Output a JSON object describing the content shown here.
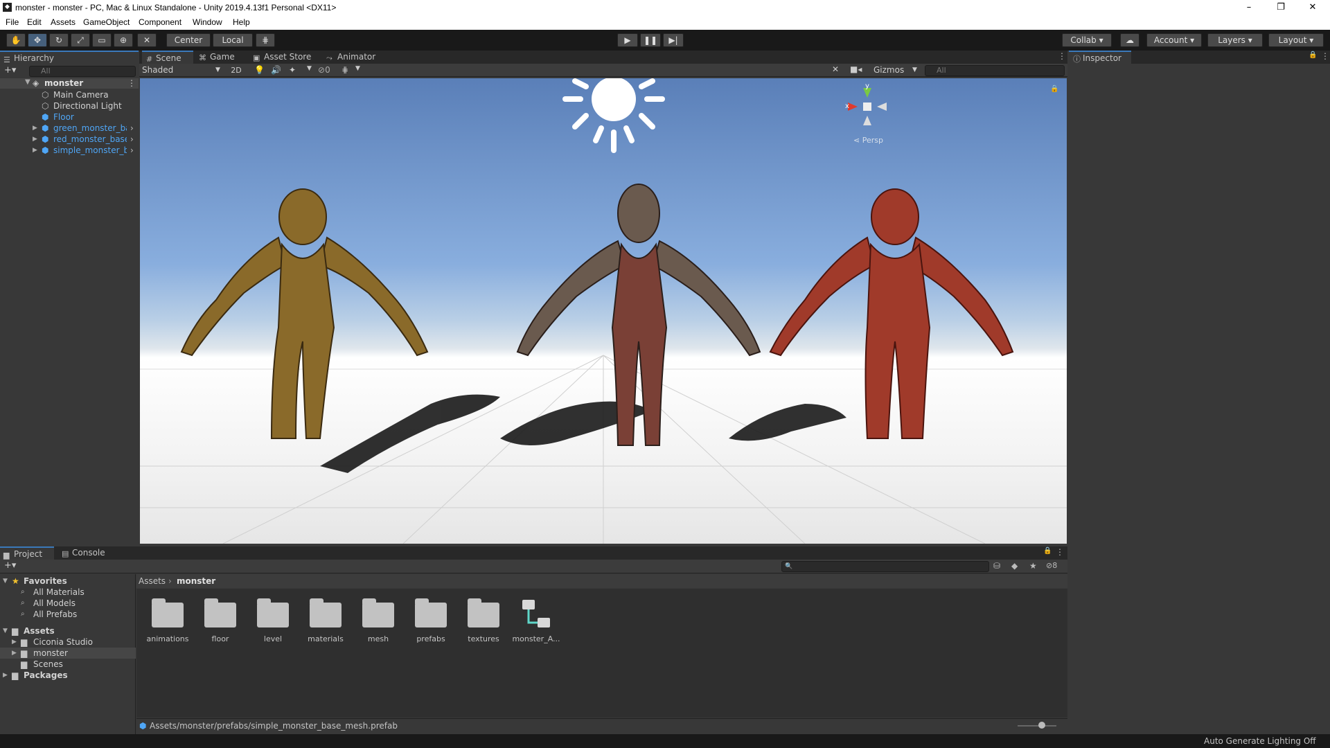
{
  "window": {
    "title": "monster - monster - PC, Mac & Linux Standalone - Unity 2019.4.13f1 Personal <DX11>",
    "minimize": "–",
    "restore": "❐",
    "close": "✕"
  },
  "menu": [
    "File",
    "Edit",
    "Assets",
    "GameObject",
    "Component",
    "Window",
    "Help"
  ],
  "toolbar": {
    "pivot": "Center",
    "space": "Local",
    "collab": "Collab",
    "account": "Account",
    "layers": "Layers",
    "layout": "Layout"
  },
  "hierarchy": {
    "tab": "Hierarchy",
    "search_placeholder": "All",
    "scene": "monster",
    "items": [
      {
        "label": "Main Camera"
      },
      {
        "label": "Directional Light"
      },
      {
        "label": "Floor"
      },
      {
        "label": "green_monster_bas"
      },
      {
        "label": "red_monster_base_"
      },
      {
        "label": "simple_monster_ba"
      }
    ]
  },
  "scene": {
    "tabs": [
      "Scene",
      "Game",
      "Asset Store",
      "Animator"
    ],
    "shading": "Shaded",
    "mode2d": "2D",
    "hidden_count": "0",
    "gizmos": "Gizmos",
    "search_placeholder": "All",
    "persp": "Persp",
    "axis_x": "x",
    "axis_y": "y"
  },
  "inspector": {
    "tab": "Inspector"
  },
  "project": {
    "tabs": [
      "Project",
      "Console"
    ],
    "favorites": "Favorites",
    "fav_items": [
      "All Materials",
      "All Models",
      "All Prefabs"
    ],
    "assets": "Assets",
    "asset_items": [
      "Ciconia Studio",
      "monster",
      "Scenes"
    ],
    "packages": "Packages",
    "breadcrumb_root": "Assets",
    "breadcrumb_current": "monster",
    "hidden_count": "8",
    "folders": [
      "animations",
      "floor",
      "level",
      "materials",
      "mesh",
      "prefabs",
      "textures",
      "monster_A..."
    ],
    "status_path": "Assets/monster/prefabs/simple_monster_base_mesh.prefab"
  },
  "statusbar": {
    "right": "Auto Generate Lighting Off"
  }
}
